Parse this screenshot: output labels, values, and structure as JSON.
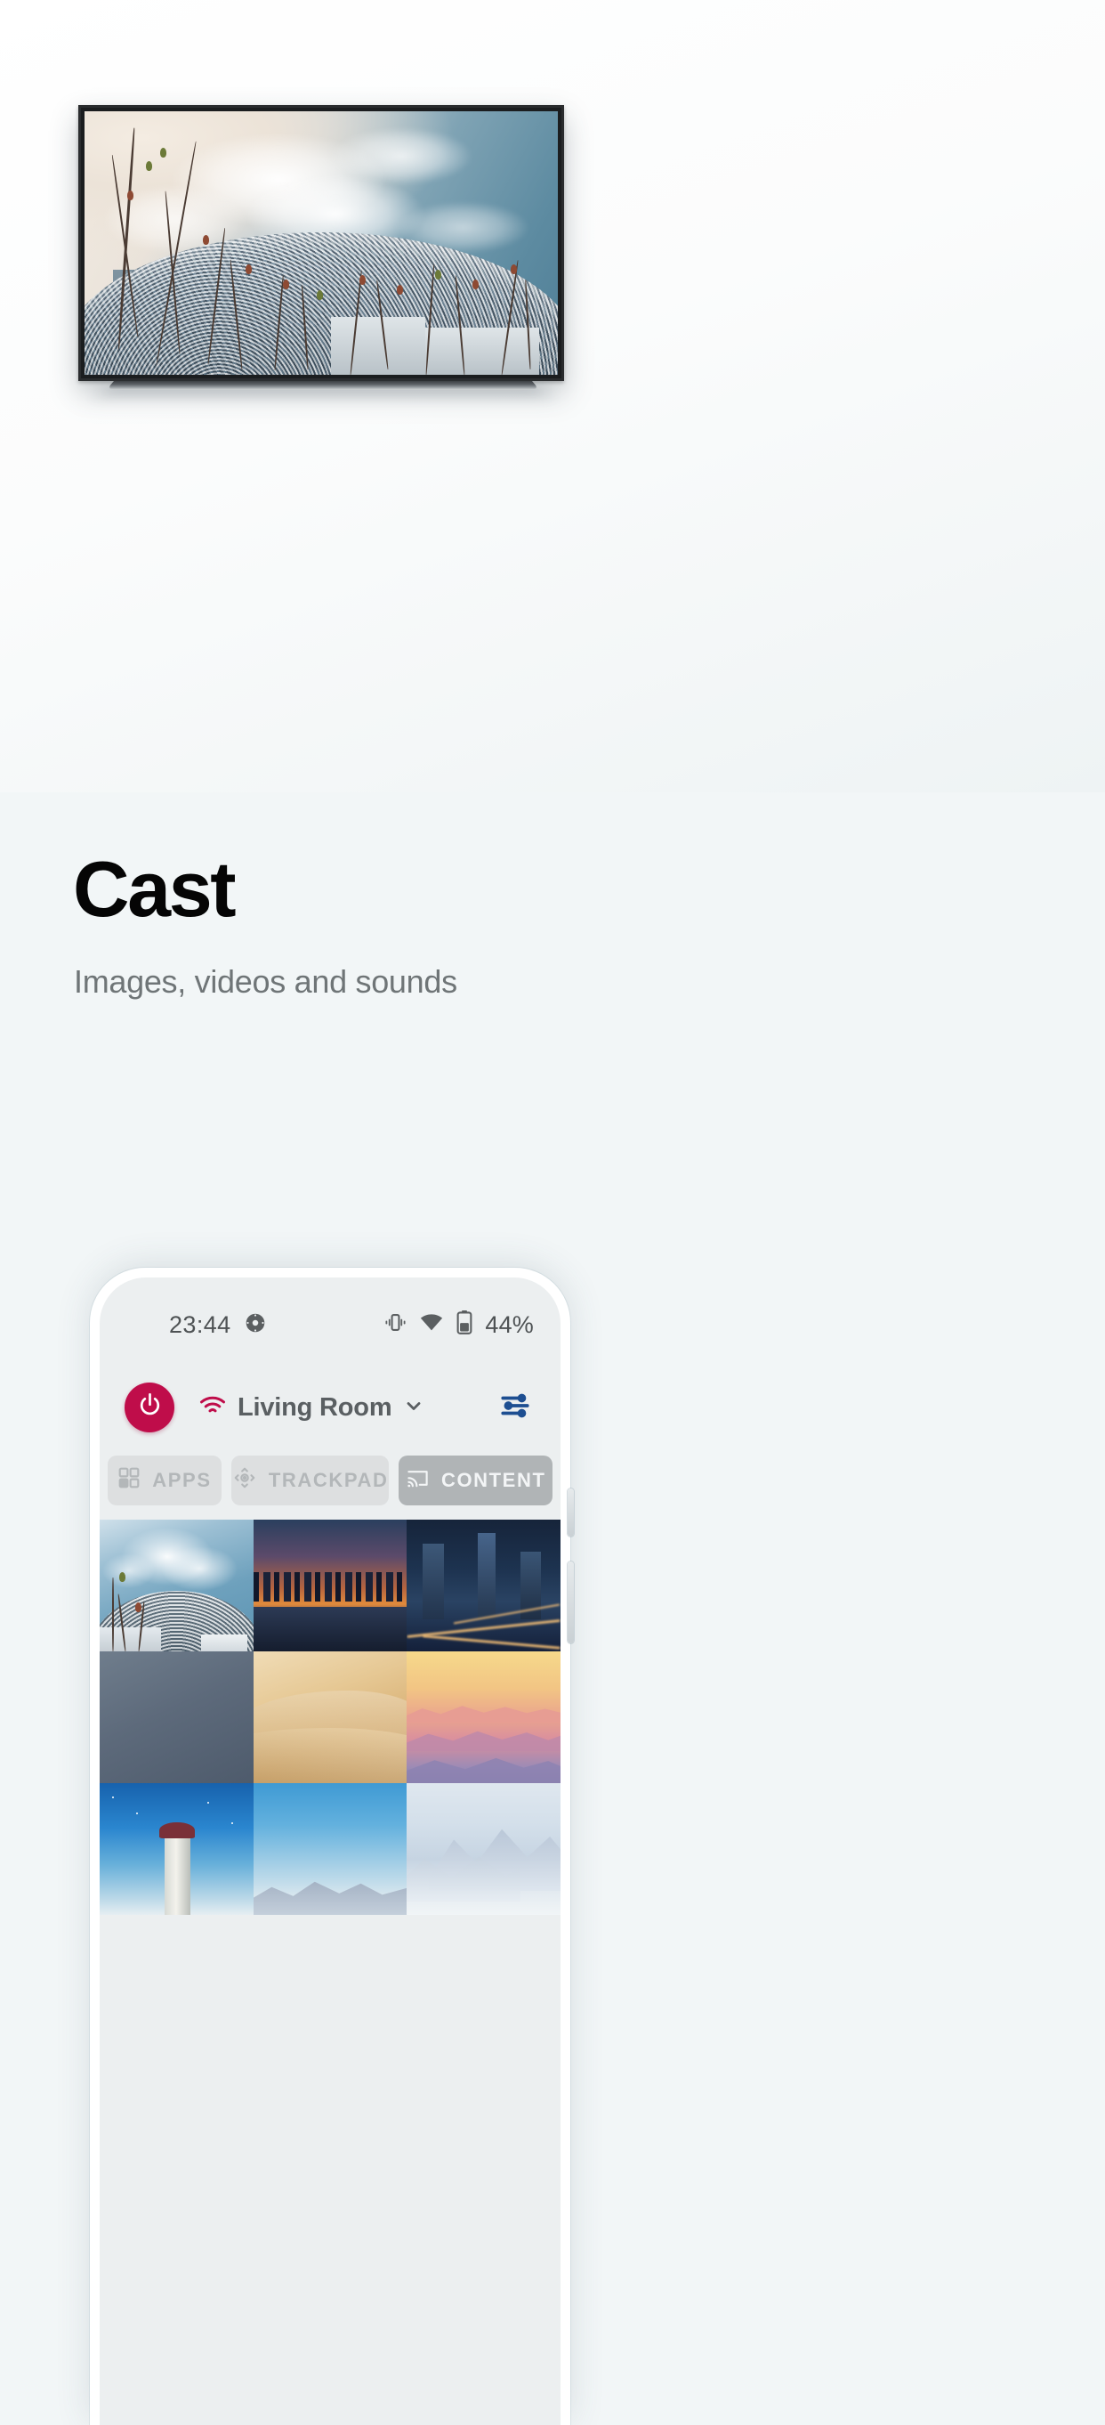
{
  "hero": {
    "tv_image_name": "louvre-abu-dhabi-dome-photo",
    "tv_alt": "Perforated dome of Louvre Abu Dhabi against blue sky with branches"
  },
  "page": {
    "title": "Cast",
    "subtitle": "Images, videos and sounds"
  },
  "phone": {
    "status_bar": {
      "time": "23:44",
      "notification_icon": "clock-icon",
      "vibrate_icon": "vibrate-icon",
      "wifi_icon": "wifi-icon",
      "battery_icon": "battery-icon",
      "battery_percent": "44%"
    },
    "app_header": {
      "power_icon": "power-icon",
      "connection_icon": "wifi-icon",
      "device_name": "Living Room",
      "dropdown_icon": "chevron-down-icon",
      "settings_icon": "sliders-icon",
      "accent_color": "#bf0d4a",
      "settings_color": "#1d4e91"
    },
    "tabs": [
      {
        "id": "apps",
        "label": "APPS",
        "icon": "grid-apps-icon",
        "active": false
      },
      {
        "id": "trackpad",
        "label": "TRACKPAD",
        "icon": "dpad-icon",
        "active": false
      },
      {
        "id": "content",
        "label": "CONTENT",
        "icon": "cast-icon",
        "active": true
      }
    ],
    "selection_color": "#2286dc",
    "content_grid": [
      {
        "name": "louvre-abu-dhabi-dome",
        "selected": true
      },
      {
        "name": "doha-skyline-sunset",
        "selected": false
      },
      {
        "name": "dubai-city-night-aerial",
        "selected": false
      },
      {
        "name": "blue-gray-gradient",
        "selected": false
      },
      {
        "name": "desert-sand-dune",
        "selected": false
      },
      {
        "name": "pink-mountain-sunset",
        "selected": false
      },
      {
        "name": "lighthouse-night-sky",
        "selected": false
      },
      {
        "name": "blue-sky-mountain-ridge",
        "selected": false
      },
      {
        "name": "misty-mountains-pale",
        "selected": false
      }
    ]
  }
}
